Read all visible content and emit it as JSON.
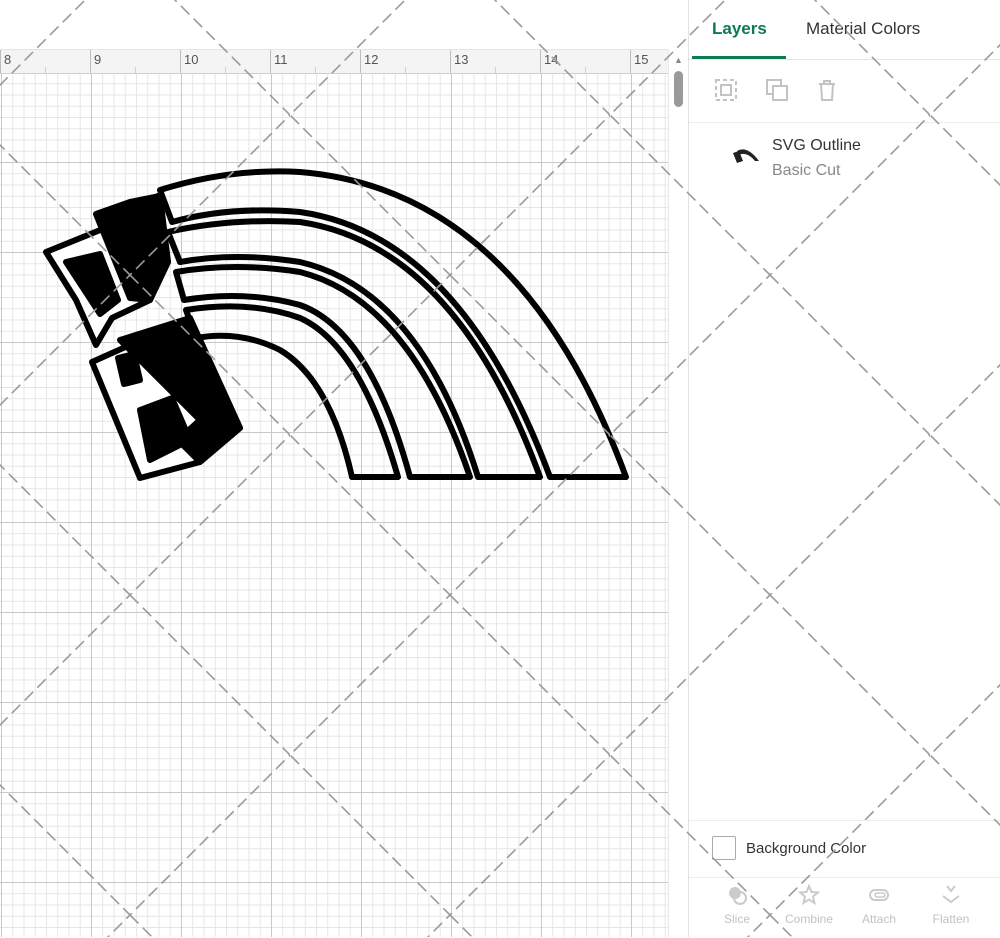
{
  "ruler": {
    "labels": [
      "8",
      "9",
      "10",
      "11",
      "12",
      "13",
      "14",
      "15"
    ]
  },
  "tabs": [
    {
      "label": "Layers"
    },
    {
      "label": "Material Colors"
    }
  ],
  "toolbar": {
    "icons": [
      "group-icon",
      "duplicate-icon",
      "delete-icon"
    ]
  },
  "layer": {
    "name": "SVG Outline",
    "type": "Basic Cut"
  },
  "background": {
    "label": "Background Color",
    "checked": false
  },
  "bottom_tools": [
    {
      "label": "Slice",
      "icon": "slice-icon"
    },
    {
      "label": "Combine",
      "icon": "combine-icon"
    },
    {
      "label": "Attach",
      "icon": "attach-icon"
    },
    {
      "label": "Flatten",
      "icon": "flatten-icon"
    }
  ],
  "colors": {
    "accent": "#0d7a50",
    "artwork": "#000000",
    "grid_major": "#c9c9c9",
    "grid_minor": "#e6e6e6"
  }
}
